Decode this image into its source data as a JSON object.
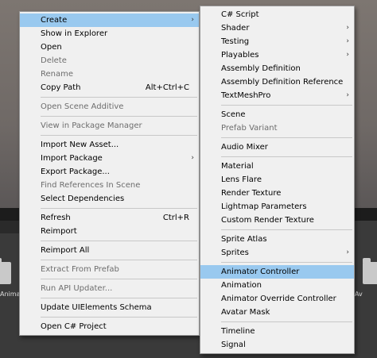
{
  "context_menu": {
    "items": [
      {
        "label": "Create",
        "submenu": true,
        "highlighted": true
      },
      {
        "label": "Show in Explorer"
      },
      {
        "label": "Open"
      },
      {
        "label": "Delete",
        "disabled": true
      },
      {
        "label": "Rename",
        "disabled": true
      },
      {
        "label": "Copy Path",
        "shortcut": "Alt+Ctrl+C"
      },
      {
        "separator": true
      },
      {
        "label": "Open Scene Additive",
        "disabled": true
      },
      {
        "separator": true
      },
      {
        "label": "View in Package Manager",
        "disabled": true
      },
      {
        "separator": true
      },
      {
        "label": "Import New Asset..."
      },
      {
        "label": "Import Package",
        "submenu": true
      },
      {
        "label": "Export Package..."
      },
      {
        "label": "Find References In Scene",
        "disabled": true
      },
      {
        "label": "Select Dependencies"
      },
      {
        "separator": true
      },
      {
        "label": "Refresh",
        "shortcut": "Ctrl+R"
      },
      {
        "label": "Reimport"
      },
      {
        "separator": true
      },
      {
        "label": "Reimport All"
      },
      {
        "separator": true
      },
      {
        "label": "Extract From Prefab",
        "disabled": true
      },
      {
        "separator": true
      },
      {
        "label": "Run API Updater...",
        "disabled": true
      },
      {
        "separator": true
      },
      {
        "label": "Update UIElements Schema"
      },
      {
        "separator": true
      },
      {
        "label": "Open C# Project"
      }
    ]
  },
  "create_submenu": {
    "items": [
      {
        "label": "C# Script"
      },
      {
        "label": "Shader",
        "submenu": true
      },
      {
        "label": "Testing",
        "submenu": true
      },
      {
        "label": "Playables",
        "submenu": true
      },
      {
        "label": "Assembly Definition"
      },
      {
        "label": "Assembly Definition Reference"
      },
      {
        "label": "TextMeshPro",
        "submenu": true
      },
      {
        "separator": true
      },
      {
        "label": "Scene"
      },
      {
        "label": "Prefab Variant",
        "disabled": true
      },
      {
        "separator": true
      },
      {
        "label": "Audio Mixer"
      },
      {
        "separator": true
      },
      {
        "label": "Material"
      },
      {
        "label": "Lens Flare"
      },
      {
        "label": "Render Texture"
      },
      {
        "label": "Lightmap Parameters"
      },
      {
        "label": "Custom Render Texture"
      },
      {
        "separator": true
      },
      {
        "label": "Sprite Atlas"
      },
      {
        "label": "Sprites",
        "submenu": true
      },
      {
        "separator": true
      },
      {
        "label": "Animator Controller",
        "highlighted": true
      },
      {
        "label": "Animation"
      },
      {
        "label": "Animator Override Controller"
      },
      {
        "label": "Avatar Mask"
      },
      {
        "separator": true
      },
      {
        "label": "Timeline"
      },
      {
        "label": "Signal"
      }
    ]
  },
  "background": {
    "asset_labels": [
      "Animat",
      "Av"
    ]
  },
  "glyphs": {
    "submenu_arrow": "›"
  },
  "colors": {
    "menu_bg": "#f0f0f0",
    "highlight": "#99c9ef",
    "disabled_text": "#6d6d6d"
  }
}
